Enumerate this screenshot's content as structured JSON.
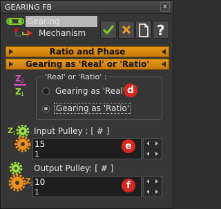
{
  "window": {
    "title": "GEARING FB",
    "close_label": "x"
  },
  "tree": {
    "selected_item": "Gearing",
    "child_item": "Mechanism"
  },
  "toolbar": {
    "ok_icon": "check-icon",
    "cancel_icon": "cross-icon",
    "new_icon": "document-icon",
    "help_label": "?"
  },
  "sections": {
    "ratio_phase": "Ratio and Phase",
    "gearing_as": "Gearing as 'Real' or 'Ratio'"
  },
  "gearing_group": {
    "legend": "'Real' or 'Ratio' :",
    "option_real": "Gearing as 'Real'",
    "option_ratio": "Gearing as 'Ratio'",
    "selected": "ratio",
    "badge": "d"
  },
  "input_pulley": {
    "label": "Input Pulley : [ # ]",
    "value": "15",
    "sub_value": "1",
    "badge": "e"
  },
  "output_pulley": {
    "label": "Output Pulley: [ # ]",
    "value": "10",
    "sub_value": "1",
    "badge": "f"
  },
  "colors": {
    "accent_orange": "#e49a1a",
    "badge_red": "#d8281e",
    "check_green": "#7fd12a",
    "cross_orange": "#f0a020"
  }
}
